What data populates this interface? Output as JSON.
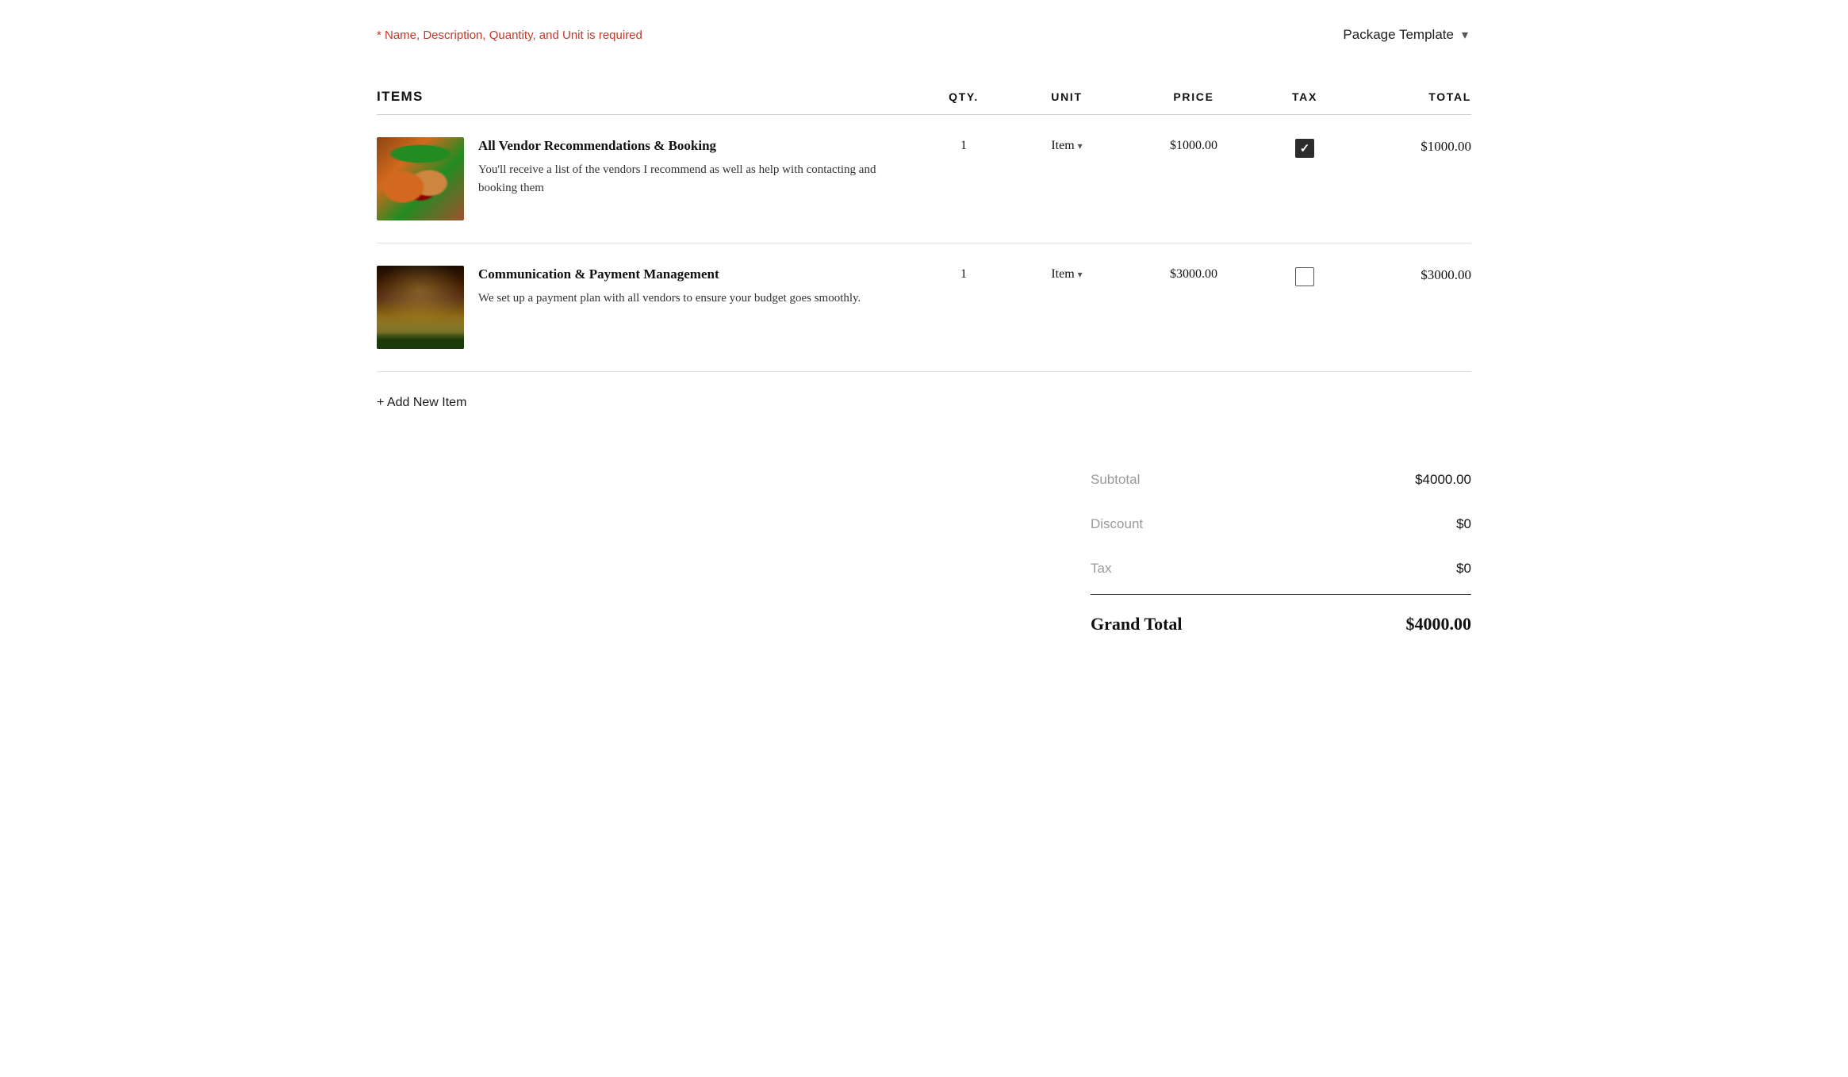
{
  "required_note": "* Name, Description, Quantity, and Unit is required",
  "package_template": {
    "label": "Package Template",
    "dropdown_icon": "▾"
  },
  "table": {
    "columns": {
      "items": "ITEMS",
      "qty": "QTY.",
      "unit": "UNIT",
      "price": "PRICE",
      "tax": "TAX",
      "total": "TOTAL"
    },
    "rows": [
      {
        "id": "row-1",
        "name": "All Vendor Recommendations & Booking",
        "description": "You'll receive a list of the vendors I recommend as well as help with contacting and booking them",
        "qty": "1",
        "unit": "Item",
        "price": "$1000.00",
        "tax_checked": true,
        "total": "$1000.00",
        "image_type": "food"
      },
      {
        "id": "row-2",
        "name": "Communication & Payment Management",
        "description": "We set up a payment plan with all vendors to ensure your budget goes smoothly.",
        "qty": "1",
        "unit": "Item",
        "price": "$3000.00",
        "tax_checked": false,
        "total": "$3000.00",
        "image_type": "wedding"
      }
    ]
  },
  "add_item": {
    "label": "+ Add New Item"
  },
  "summary": {
    "subtotal_label": "Subtotal",
    "subtotal_value": "$4000.00",
    "discount_label": "Discount",
    "discount_value": "$0",
    "tax_label": "Tax",
    "tax_value": "$0",
    "grand_total_label": "Grand Total",
    "grand_total_value": "$4000.00"
  }
}
